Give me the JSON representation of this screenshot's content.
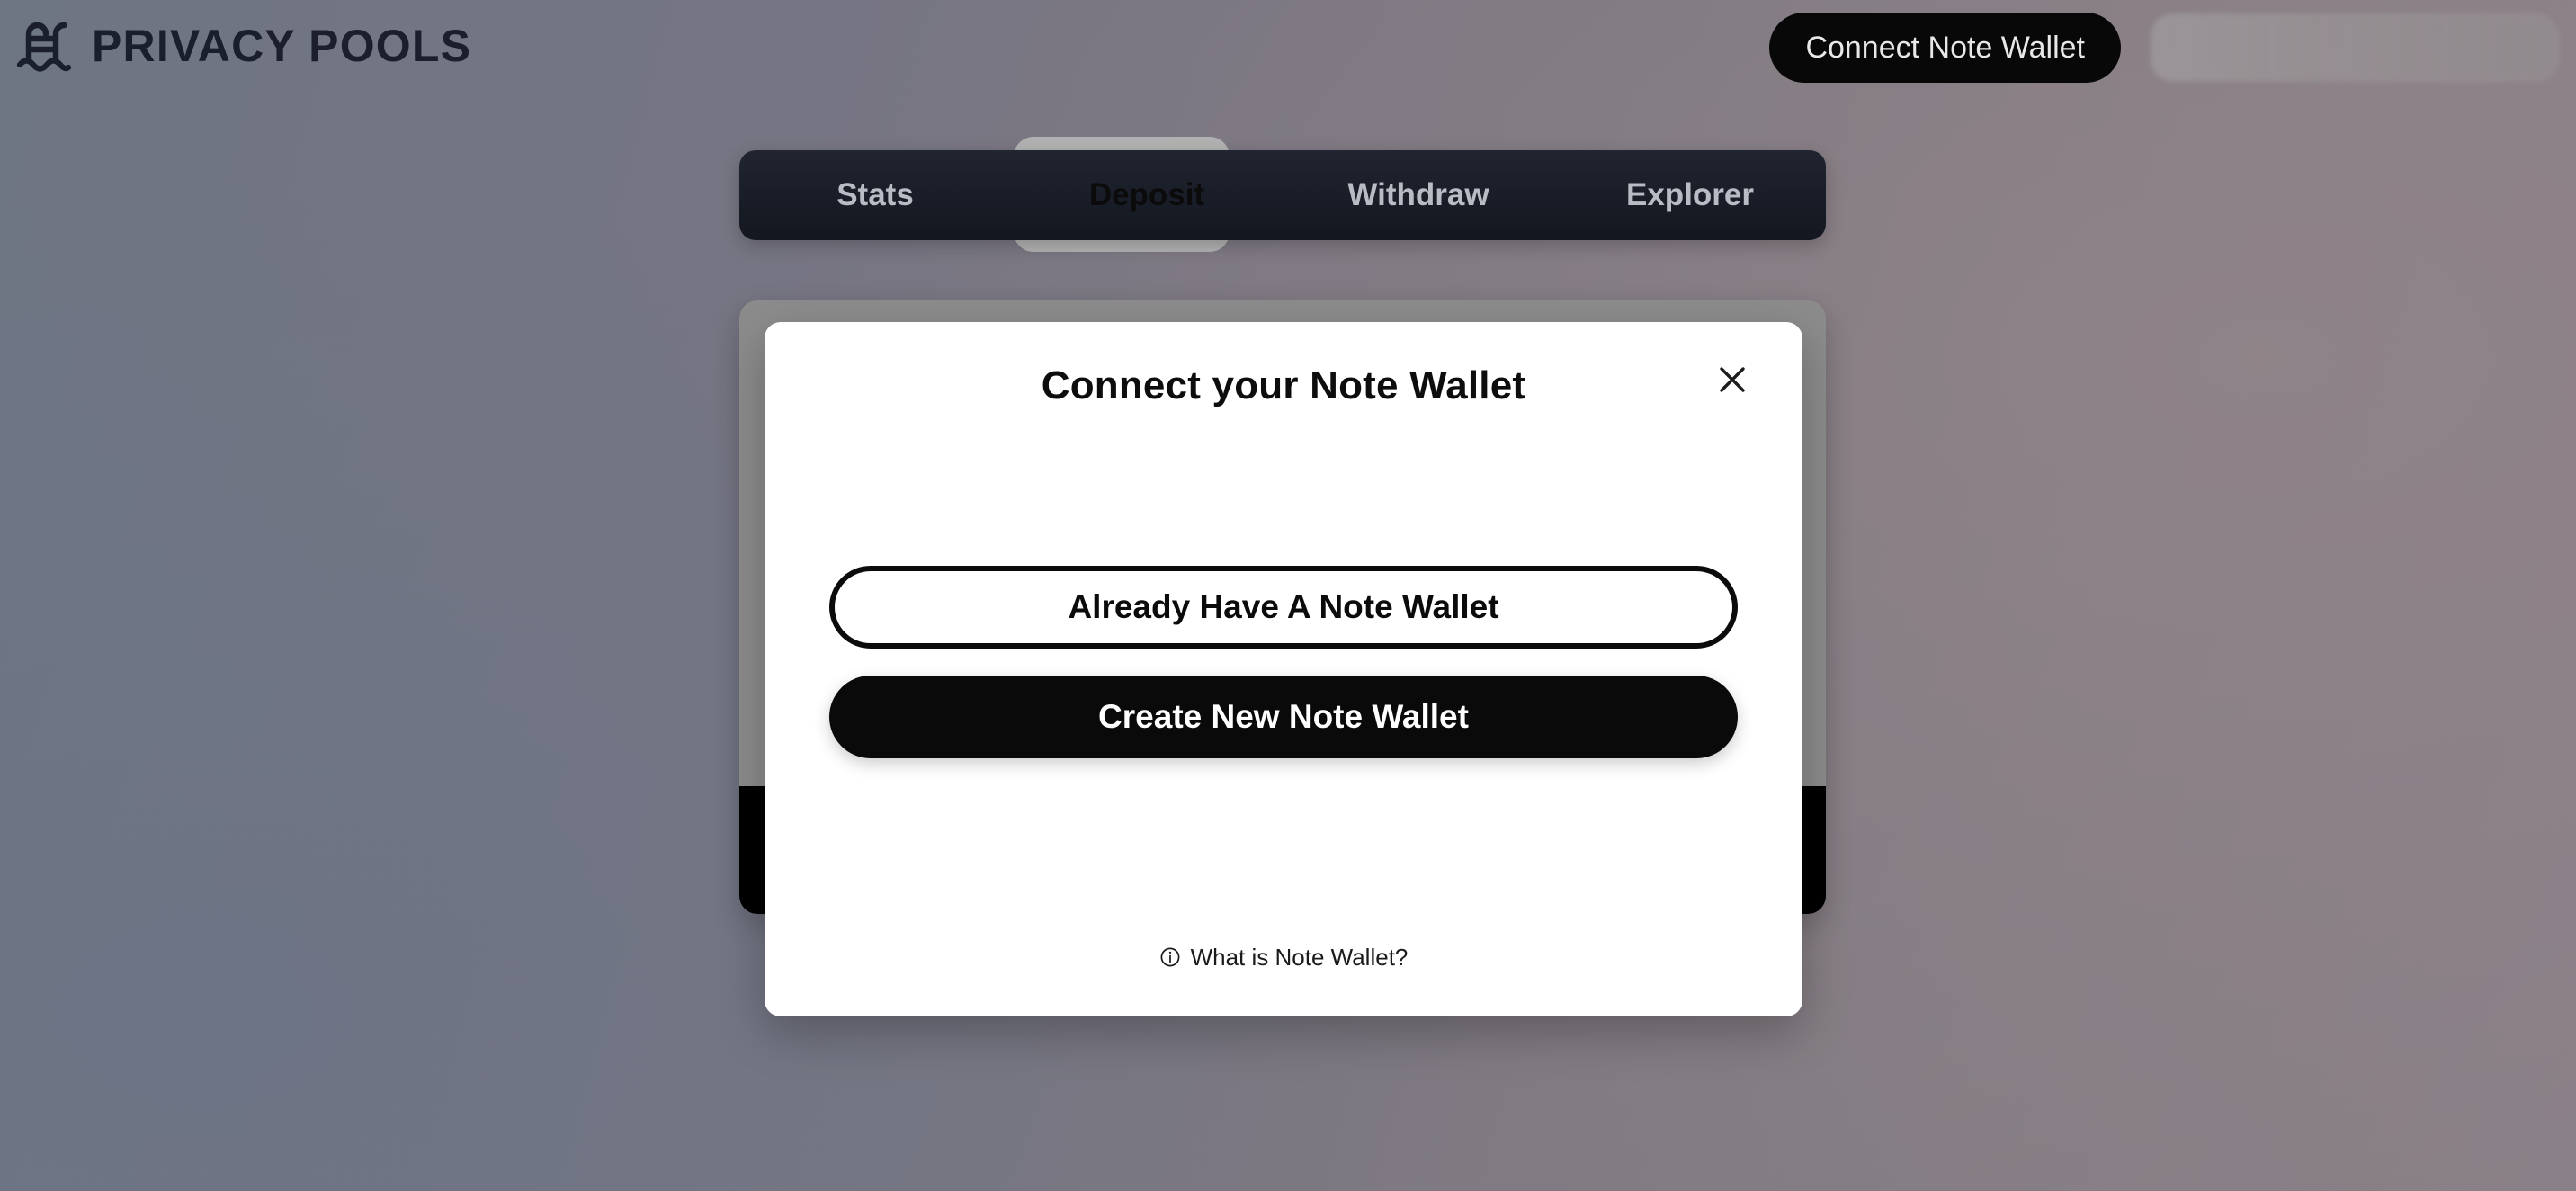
{
  "header": {
    "brand_title": "PRIVACY POOLS",
    "logo_icon": "pool-ladder-icon",
    "connect_button_label": "Connect Note Wallet",
    "wallet_skeleton_label": ""
  },
  "tabs": {
    "items": [
      {
        "label": "Stats",
        "active": false
      },
      {
        "label": "Deposit",
        "active": true
      },
      {
        "label": "Withdraw",
        "active": false
      },
      {
        "label": "Explorer",
        "active": false
      }
    ],
    "active_index": 1
  },
  "modal": {
    "title": "Connect your Note Wallet",
    "close_icon": "close-x-icon",
    "primary_outline_button": "Already Have A Note Wallet",
    "primary_filled_button": "Create New Note Wallet",
    "footer": {
      "icon": "info-circle-icon",
      "label": "What is Note Wallet?"
    }
  },
  "colors": {
    "brand_text": "#1b1f2c",
    "tabbar_bg": "#191d27",
    "tab_active_bg": "#b2b2b2",
    "panel_card_bg": "#8d8c8c",
    "panel_card_bottom": "#000000",
    "modal_bg": "#ffffff",
    "button_black": "#0a0a0a",
    "connect_button_bg": "#080808",
    "background_left": "#6e7583",
    "background_right": "#8a8087"
  }
}
